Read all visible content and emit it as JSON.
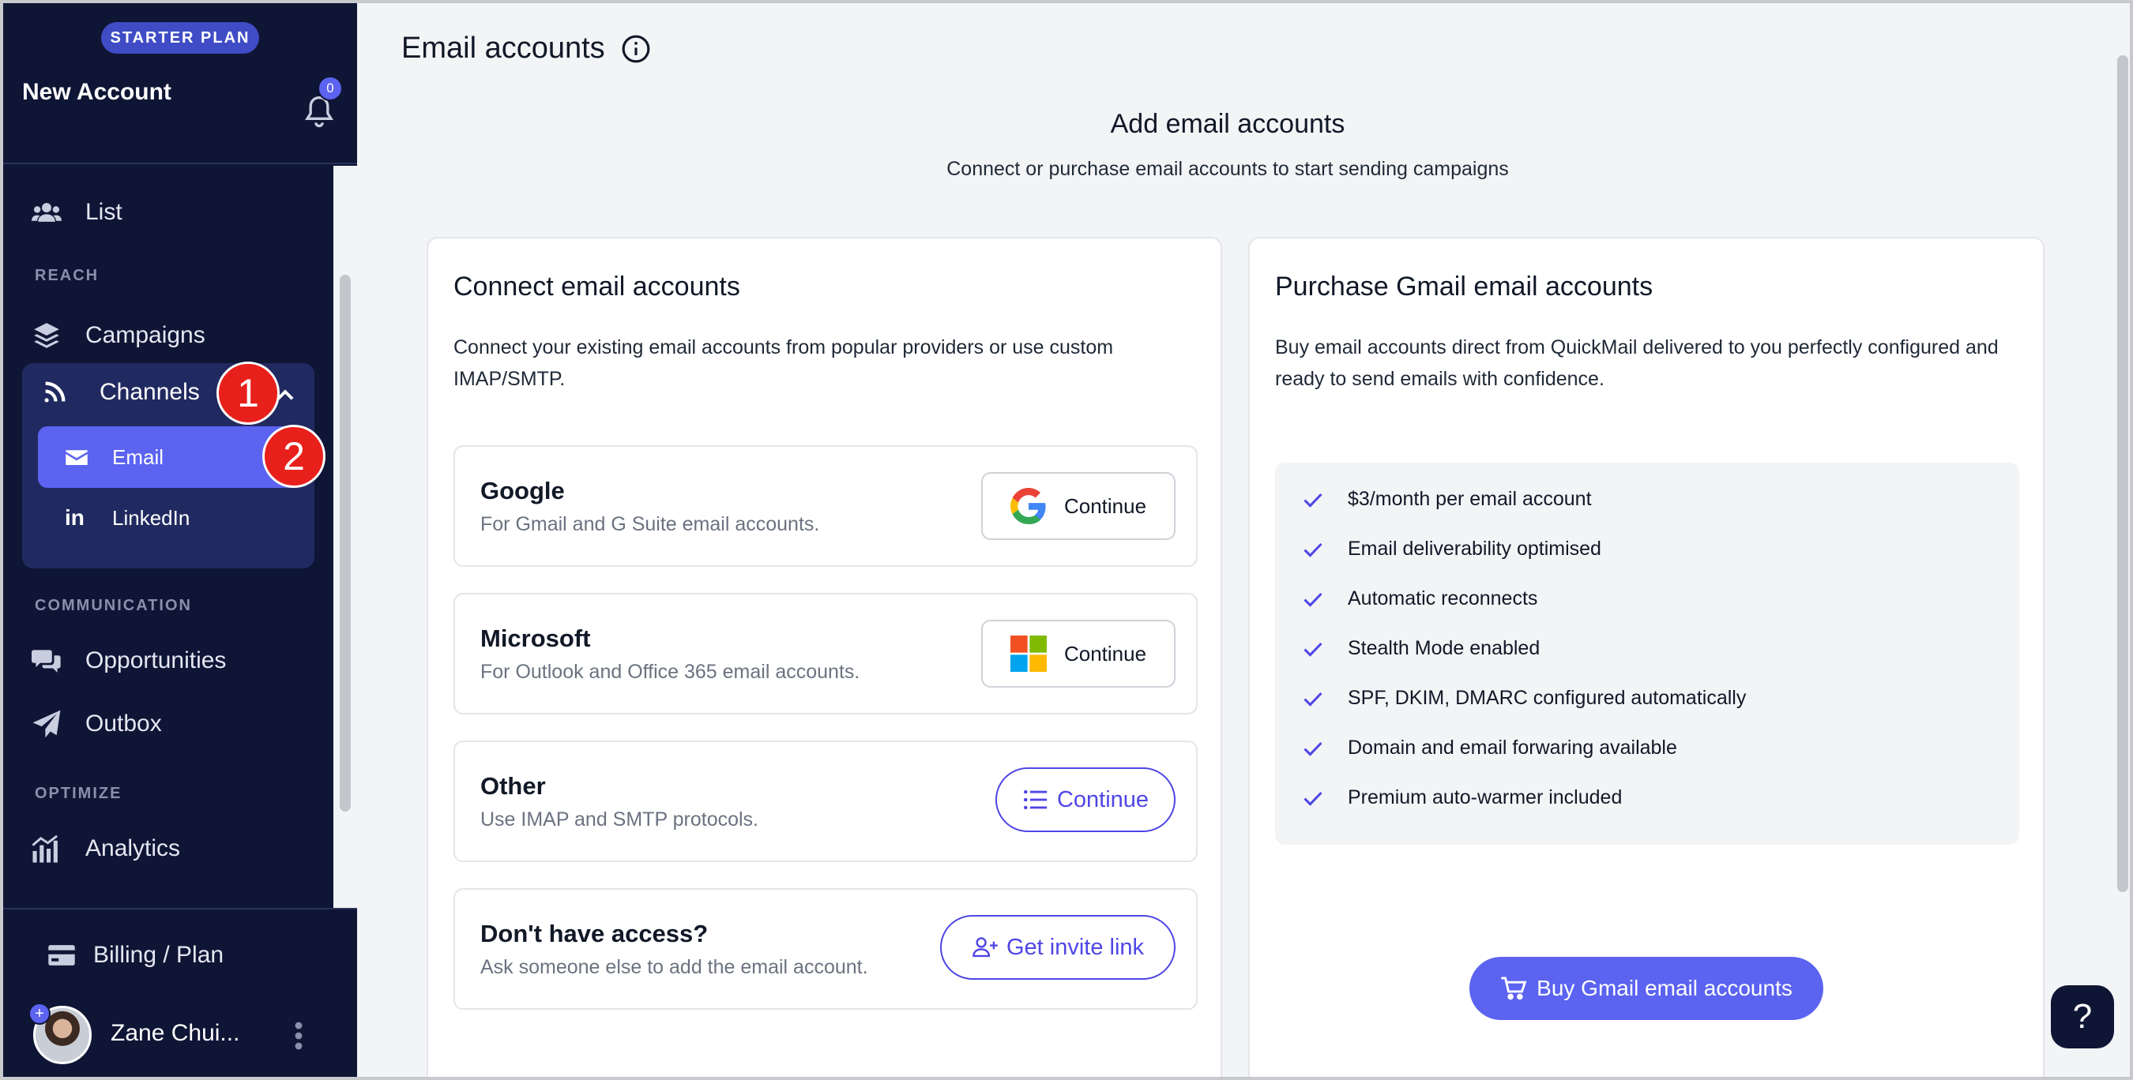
{
  "sidebar": {
    "plan_badge": "STARTER PLAN",
    "account_name": "New Account",
    "notification_count": "0",
    "items": {
      "list": "List",
      "campaigns": "Campaigns",
      "channels": "Channels",
      "email": "Email",
      "linkedin": "LinkedIn",
      "opportunities": "Opportunities",
      "outbox": "Outbox",
      "analytics": "Analytics"
    },
    "sections": {
      "reach": "REACH",
      "communication": "COMMUNICATION",
      "optimize": "OPTIMIZE"
    },
    "billing": "Billing / Plan",
    "user_name": "Zane Chui...",
    "avatar_plus": "+",
    "linkedin_glyph": "in"
  },
  "annotations": {
    "step1": "1",
    "step2": "2"
  },
  "main": {
    "page_title": "Email accounts",
    "hero_title": "Add email accounts",
    "hero_subtitle": "Connect or purchase email accounts to start sending campaigns"
  },
  "connect_card": {
    "title": "Connect email accounts",
    "description": "Connect your existing email accounts from popular providers or use custom IMAP/SMTP.",
    "providers": [
      {
        "name": "Google",
        "desc": "For Gmail and G Suite email accounts.",
        "button": "Continue"
      },
      {
        "name": "Microsoft",
        "desc": "For Outlook and Office 365 email accounts.",
        "button": "Continue"
      },
      {
        "name": "Other",
        "desc": "Use IMAP and SMTP protocols.",
        "button": "Continue"
      },
      {
        "name": "Don't have access?",
        "desc": "Ask someone else to add the email account.",
        "button": "Get invite link"
      }
    ]
  },
  "purchase_card": {
    "title": "Purchase Gmail email accounts",
    "description": "Buy email accounts direct from QuickMail delivered to you perfectly configured and ready to send emails with confidence.",
    "features": [
      "$3/month per email account",
      "Email deliverability optimised",
      "Automatic reconnects",
      "Stealth Mode enabled",
      "SPF, DKIM, DMARC configured automatically",
      "Domain and email forwaring available",
      "Premium auto-warmer included"
    ],
    "buy_button": "Buy Gmail email accounts"
  },
  "help": {
    "label": "?"
  },
  "colors": {
    "sidebar_bg": "#0f1535",
    "accent": "#5b63f0",
    "outline_accent": "#4f46e5",
    "annotation_red": "#e8201b"
  },
  "icons": {
    "list": "users-icon",
    "campaigns": "layers-icon",
    "channels": "rss-icon",
    "email": "envelope-icon",
    "opportunities": "chat-icon",
    "outbox": "paper-plane-icon",
    "analytics": "chart-icon",
    "billing": "credit-card-icon"
  }
}
